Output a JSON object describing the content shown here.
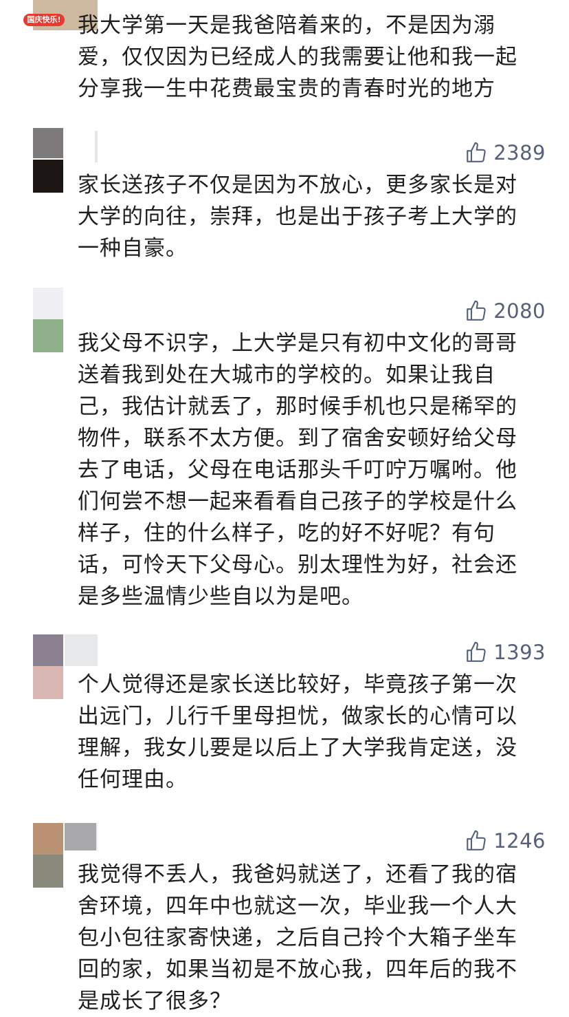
{
  "comments": [
    {
      "badge": "国庆快乐!",
      "text": "我大学第一天是我爸陪着来的，不是因为溺\n爱，仅仅因为已经成人的我需要让他和我一起\n分享我一生中花费最宝贵的青春时光的地方"
    },
    {
      "likes": "2389",
      "text": "家长送孩子不仅是因为不放心，更多家长是对\n大学的向往，崇拜，也是出于孩子考上大学的\n一种自豪。"
    },
    {
      "likes": "2080",
      "text": "我父母不识字，上大学是只有初中文化的哥哥\n送着我到处在大城市的学校的。如果让我自\n己，我估计就丢了，那时候手机也只是稀罕的\n物件，联系不太方便。到了宿舍安顿好给父母\n去了电话，父母在电话那头千叮咛万嘱咐。他\n们何尝不想一起来看看自己孩子的学校是什么\n样子，住的什么样子，吃的好不好呢？有句\n话，可怜天下父母心。别太理性为好，社会还\n是多些温情少些自以为是吧。"
    },
    {
      "likes": "1393",
      "text": "个人觉得还是家长送比较好，毕竟孩子第一次\n出远门，儿行千里母担忧，做家长的心情可以\n理解，我女儿要是以后上了大学我肯定送，没\n任何理由。"
    },
    {
      "likes": "1246",
      "text": "我觉得不丢人，我爸妈就送了，还看了我的宿\n舍环境，四年中也就这一次，毕业我一个人大\n包小包往家寄快递，之后自己拎个大箱子坐车\n回的家，如果当初是不放心我，四年后的我不\n是成长了很多？"
    }
  ],
  "icons": {
    "like": "thumbs-up-icon"
  },
  "colors": {
    "like": "#55617a",
    "text": "#1f1f1f",
    "badge": "#e63b2e"
  }
}
